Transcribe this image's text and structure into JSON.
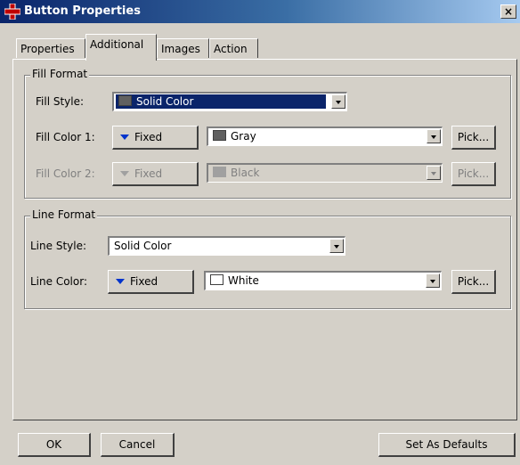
{
  "window": {
    "title": "Button Properties",
    "close_glyph": "×"
  },
  "tabs": [
    {
      "label": "Properties",
      "active": false
    },
    {
      "label": "Additional",
      "active": true
    },
    {
      "label": "Images",
      "active": false
    },
    {
      "label": "Action",
      "active": false
    }
  ],
  "fill_format": {
    "legend": "Fill Format",
    "fill_style_label": "Fill Style:",
    "fill_style_value": "Solid Color",
    "fill_color_1_label": "Fill Color 1:",
    "fill_color_1_mode": "Fixed",
    "fill_color_1_value": "Gray",
    "fill_color_2_label": "Fill Color 2:",
    "fill_color_2_mode": "Fixed",
    "fill_color_2_value": "Black",
    "pick_label": "Pick..."
  },
  "line_format": {
    "legend": "Line Format",
    "line_style_label": "Line Style:",
    "line_style_value": "Solid Color",
    "line_color_label": "Line Color:",
    "line_color_mode": "Fixed",
    "line_color_value": "White",
    "pick_label": "Pick..."
  },
  "footer": {
    "ok_label": "OK",
    "cancel_label": "Cancel",
    "defaults_label": "Set As Defaults"
  },
  "colors": {
    "fill_style_swatch": "#606060",
    "gray": "#606060",
    "black": "#a0a0a0",
    "white": "#ffffff",
    "title_bar": "#0a246a",
    "app_icon": "#c00000"
  }
}
